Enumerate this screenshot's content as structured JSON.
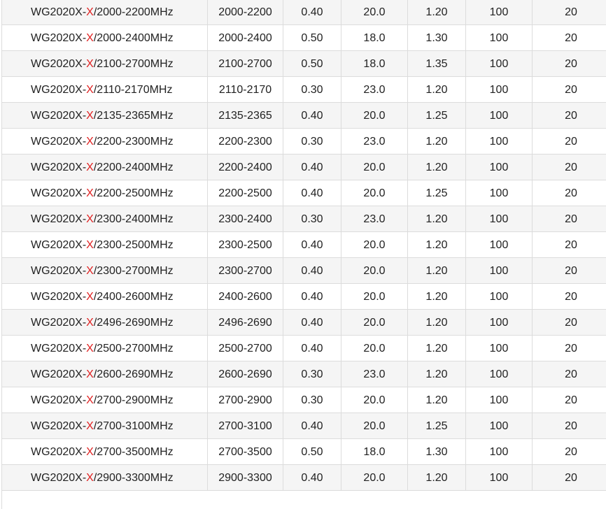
{
  "colors": {
    "model_highlight": "#e02020",
    "row_alt": "#f5f5f5",
    "border": "#dcdcdc"
  },
  "rows": [
    {
      "prefix": "WG2020X-",
      "mark": "X",
      "suffix": "/2000-2200MHz",
      "range": "2000-2200",
      "v1": "0.40",
      "v2": "20.0",
      "v3": "1.20",
      "v4": "100",
      "v5": "20"
    },
    {
      "prefix": "WG2020X-",
      "mark": "X",
      "suffix": "/2000-2400MHz",
      "range": "2000-2400",
      "v1": "0.50",
      "v2": "18.0",
      "v3": "1.30",
      "v4": "100",
      "v5": "20"
    },
    {
      "prefix": "WG2020X-",
      "mark": "X",
      "suffix": "/2100-2700MHz",
      "range": "2100-2700",
      "v1": "0.50",
      "v2": "18.0",
      "v3": "1.35",
      "v4": "100",
      "v5": "20"
    },
    {
      "prefix": "WG2020X-",
      "mark": "X",
      "suffix": "/2110-2170MHz",
      "range": "2110-2170",
      "v1": "0.30",
      "v2": "23.0",
      "v3": "1.20",
      "v4": "100",
      "v5": "20"
    },
    {
      "prefix": "WG2020X-",
      "mark": "X",
      "suffix": "/2135-2365MHz",
      "range": "2135-2365",
      "v1": "0.40",
      "v2": "20.0",
      "v3": "1.25",
      "v4": "100",
      "v5": "20"
    },
    {
      "prefix": "WG2020X-",
      "mark": "X",
      "suffix": "/2200-2300MHz",
      "range": "2200-2300",
      "v1": "0.30",
      "v2": "23.0",
      "v3": "1.20",
      "v4": "100",
      "v5": "20"
    },
    {
      "prefix": "WG2020X-",
      "mark": "X",
      "suffix": "/2200-2400MHz",
      "range": "2200-2400",
      "v1": "0.40",
      "v2": "20.0",
      "v3": "1.20",
      "v4": "100",
      "v5": "20"
    },
    {
      "prefix": "WG2020X-",
      "mark": "X",
      "suffix": "/2200-2500MHz",
      "range": "2200-2500",
      "v1": "0.40",
      "v2": "20.0",
      "v3": "1.25",
      "v4": "100",
      "v5": "20"
    },
    {
      "prefix": "WG2020X-",
      "mark": "X",
      "suffix": "/2300-2400MHz",
      "range": "2300-2400",
      "v1": "0.30",
      "v2": "23.0",
      "v3": "1.20",
      "v4": "100",
      "v5": "20"
    },
    {
      "prefix": "WG2020X-",
      "mark": "X",
      "suffix": "/2300-2500MHz",
      "range": "2300-2500",
      "v1": "0.40",
      "v2": "20.0",
      "v3": "1.20",
      "v4": "100",
      "v5": "20"
    },
    {
      "prefix": "WG2020X-",
      "mark": "X",
      "suffix": "/2300-2700MHz",
      "range": "2300-2700",
      "v1": "0.40",
      "v2": "20.0",
      "v3": "1.20",
      "v4": "100",
      "v5": "20"
    },
    {
      "prefix": "WG2020X-",
      "mark": "X",
      "suffix": "/2400-2600MHz",
      "range": "2400-2600",
      "v1": "0.40",
      "v2": "20.0",
      "v3": "1.20",
      "v4": "100",
      "v5": "20"
    },
    {
      "prefix": "WG2020X-",
      "mark": "X",
      "suffix": "/2496-2690MHz",
      "range": "2496-2690",
      "v1": "0.40",
      "v2": "20.0",
      "v3": "1.20",
      "v4": "100",
      "v5": "20"
    },
    {
      "prefix": "WG2020X-",
      "mark": "X",
      "suffix": "/2500-2700MHz",
      "range": "2500-2700",
      "v1": "0.40",
      "v2": "20.0",
      "v3": "1.20",
      "v4": "100",
      "v5": "20"
    },
    {
      "prefix": "WG2020X-",
      "mark": "X",
      "suffix": "/2600-2690MHz",
      "range": "2600-2690",
      "v1": "0.30",
      "v2": "23.0",
      "v3": "1.20",
      "v4": "100",
      "v5": "20"
    },
    {
      "prefix": "WG2020X-",
      "mark": "X",
      "suffix": "/2700-2900MHz",
      "range": "2700-2900",
      "v1": "0.30",
      "v2": "20.0",
      "v3": "1.20",
      "v4": "100",
      "v5": "20"
    },
    {
      "prefix": "WG2020X-",
      "mark": "X",
      "suffix": "/2700-3100MHz",
      "range": "2700-3100",
      "v1": "0.40",
      "v2": "20.0",
      "v3": "1.25",
      "v4": "100",
      "v5": "20"
    },
    {
      "prefix": "WG2020X-",
      "mark": "X",
      "suffix": "/2700-3500MHz",
      "range": "2700-3500",
      "v1": "0.50",
      "v2": "18.0",
      "v3": "1.30",
      "v4": "100",
      "v5": "20"
    },
    {
      "prefix": "WG2020X-",
      "mark": "X",
      "suffix": "/2900-3300MHz",
      "range": "2900-3300",
      "v1": "0.40",
      "v2": "20.0",
      "v3": "1.20",
      "v4": "100",
      "v5": "20"
    }
  ]
}
